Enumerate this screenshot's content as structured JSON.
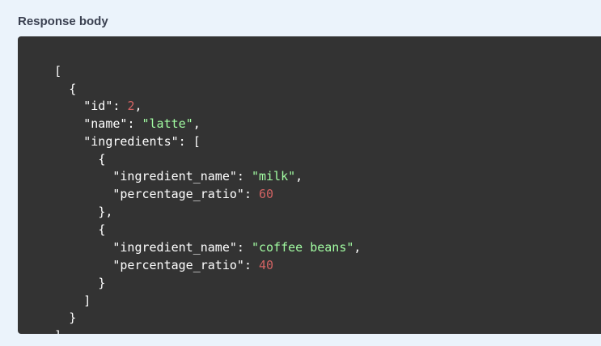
{
  "section": {
    "title": "Response body"
  },
  "colors": {
    "background": "#ebf3fb",
    "code_background": "#333333",
    "string": "#a2fca2",
    "number": "#d36363",
    "punctuation": "#ffffff"
  },
  "json_response": {
    "open_bracket": "[",
    "open_brace": "{",
    "id_key": "\"id\"",
    "id_value": "2",
    "name_key": "\"name\"",
    "name_value": "\"latte\"",
    "ingredients_key": "\"ingredients\"",
    "ingredients": [
      {
        "name_key": "\"ingredient_name\"",
        "name_value": "\"milk\"",
        "ratio_key": "\"percentage_ratio\"",
        "ratio_value": "60"
      },
      {
        "name_key": "\"ingredient_name\"",
        "name_value": "\"coffee beans\"",
        "ratio_key": "\"percentage_ratio\"",
        "ratio_value": "40"
      }
    ],
    "close_bracket": "]",
    "close_brace": "}"
  }
}
